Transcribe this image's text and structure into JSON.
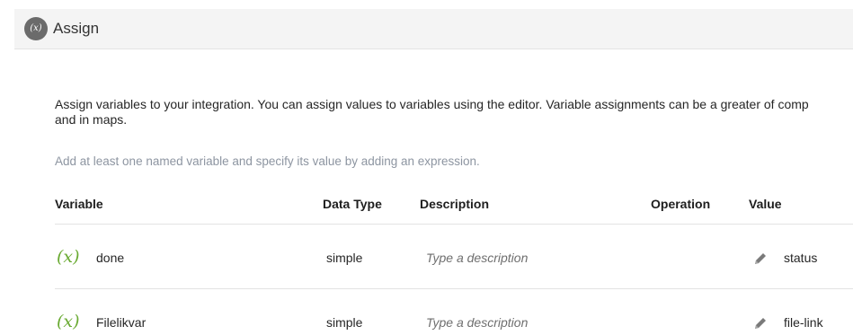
{
  "header": {
    "badge_text": "(x)",
    "title": "Assign"
  },
  "intro": {
    "line1": "Assign variables to your integration. You can assign values to variables using the editor. Variable assignments can be a greater of comp",
    "line2": "and in maps."
  },
  "hint": "Add at least one named variable and specify its value by adding an expression.",
  "table": {
    "columns": [
      "Variable",
      "Data Type",
      "Description",
      "Operation",
      "Value"
    ],
    "rows": [
      {
        "icon": "(x)",
        "variable": "done",
        "data_type": "simple",
        "description_placeholder": "Type a description",
        "operation": "",
        "value": "status"
      },
      {
        "icon": "(x)",
        "variable": "Filelikvar",
        "data_type": "simple",
        "description_placeholder": "Type a description",
        "operation": "",
        "value": "file-link"
      }
    ]
  },
  "colors": {
    "variable_icon": "#6bab34",
    "header_background": "#f4f4f4",
    "badge_background": "#6b6b6b",
    "hint_text": "#8d95a1"
  },
  "icons": {
    "header_badge": "variable-badge-icon",
    "row_variable": "variable-x-icon",
    "edit": "pencil-icon"
  }
}
